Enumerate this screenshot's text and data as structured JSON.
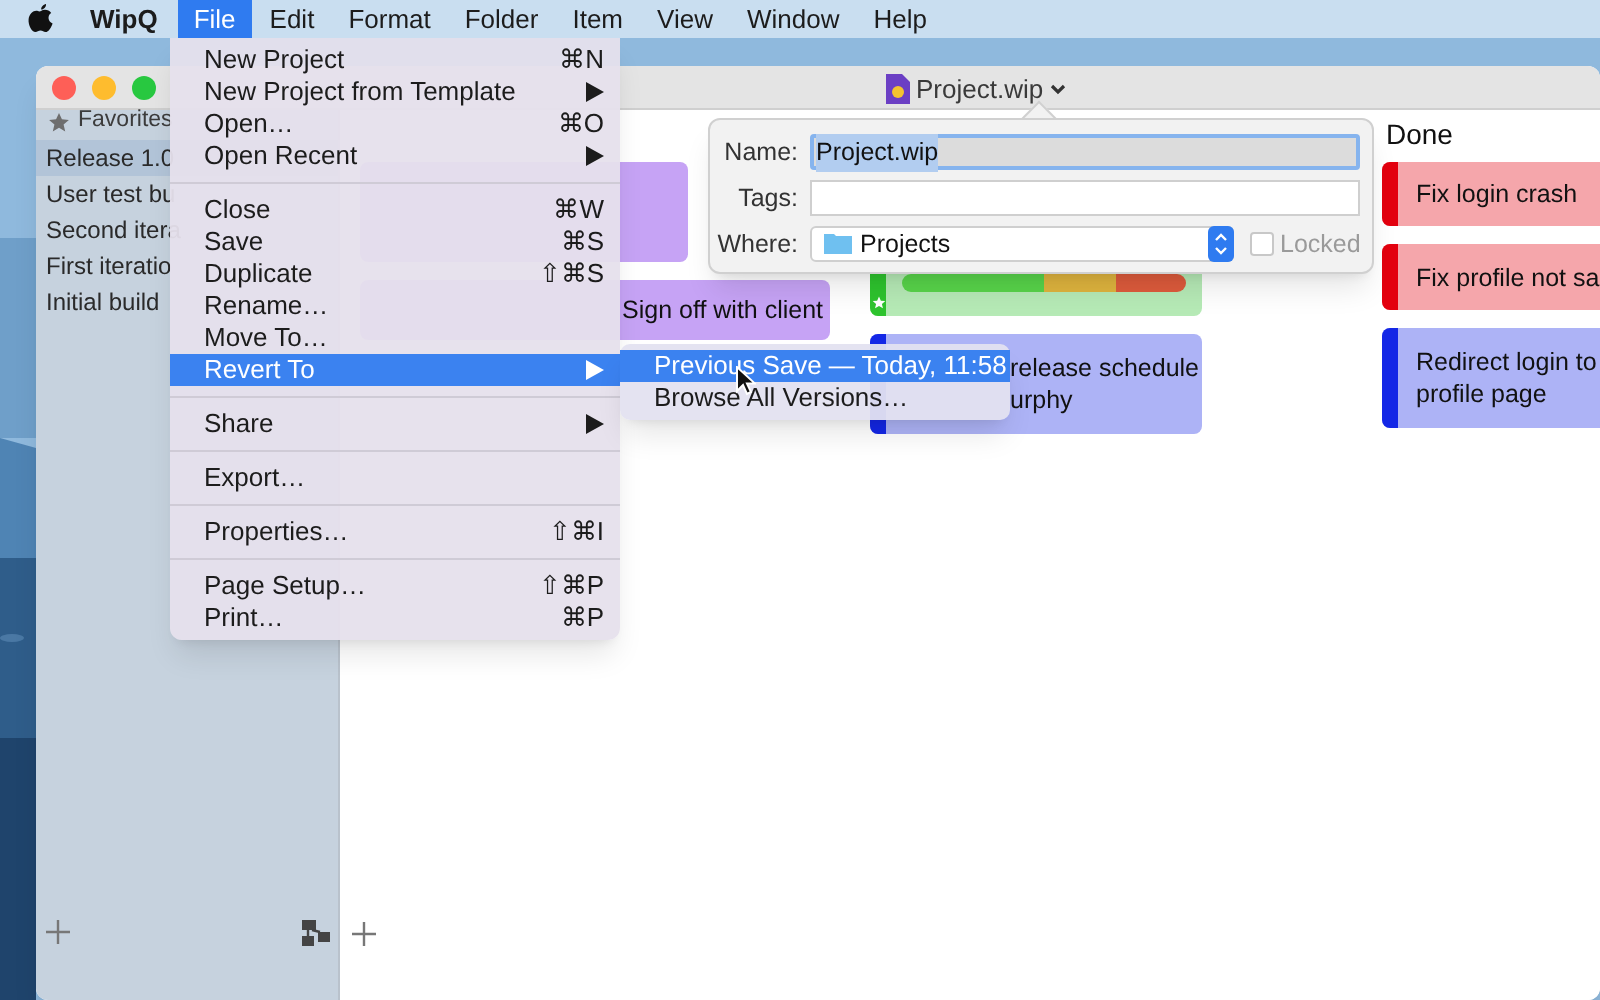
{
  "menu_bar": {
    "app": "WipQ",
    "menus": [
      {
        "label": "File",
        "selected": true
      },
      {
        "label": "Edit",
        "selected": false
      },
      {
        "label": "Format",
        "selected": false
      },
      {
        "label": "Folder",
        "selected": false
      },
      {
        "label": "Item",
        "selected": false
      },
      {
        "label": "View",
        "selected": false
      },
      {
        "label": "Window",
        "selected": false
      },
      {
        "label": "Help",
        "selected": false
      }
    ]
  },
  "window": {
    "title": "Project.wip"
  },
  "sidebar": {
    "favorites": "Favorites",
    "items": [
      {
        "label": "Release 1.0",
        "selected": true
      },
      {
        "label": "User test bu",
        "selected": false
      },
      {
        "label": "Second itera",
        "selected": false
      },
      {
        "label": "First iteratio",
        "selected": false
      },
      {
        "label": "Initial build",
        "selected": false
      }
    ]
  },
  "board": {
    "columns": [
      {
        "cards": [
          {
            "kind": "plain",
            "color": "#c6a3f5"
          },
          {
            "kind": "plain",
            "color": "#c6a3f5",
            "lines": [
              "Sign off with client"
            ]
          }
        ]
      },
      {
        "cards": [
          {
            "color": "#2ec42e",
            "starred": true,
            "kind": "progress"
          },
          {
            "color": "#1427e6",
            "lines": [
              "release schedule",
              "urphy"
            ]
          }
        ]
      },
      {
        "header": "Done",
        "cards": [
          {
            "color": "#e3000f",
            "lines": [
              "Fix login crash"
            ]
          },
          {
            "color": "#e3000f",
            "lines": [
              "Fix profile not sa"
            ]
          },
          {
            "color": "#1427e6",
            "lines": [
              "Redirect login to",
              "profile page"
            ]
          }
        ]
      }
    ]
  },
  "file_menu": {
    "sections": [
      [
        {
          "label": "New Project",
          "shortcut": "⌘N",
          "submenu": false,
          "selected": false
        },
        {
          "label": "New Project from Template",
          "submenu": true,
          "selected": false
        },
        {
          "label": "Open…",
          "shortcut": "⌘O",
          "submenu": false,
          "selected": false
        },
        {
          "label": "Open Recent",
          "submenu": true,
          "selected": false
        }
      ],
      [
        {
          "label": "Close",
          "shortcut": "⌘W",
          "submenu": false,
          "selected": false
        },
        {
          "label": "Save",
          "shortcut": "⌘S",
          "submenu": false,
          "selected": false
        },
        {
          "label": "Duplicate",
          "shortcut": "⇧⌘S",
          "submenu": false,
          "selected": false
        },
        {
          "label": "Rename…",
          "submenu": false,
          "selected": false
        },
        {
          "label": "Move To…",
          "submenu": false,
          "selected": false
        },
        {
          "label": "Revert To",
          "submenu": true,
          "selected": true
        }
      ],
      [
        {
          "label": "Share",
          "submenu": true,
          "selected": false
        }
      ],
      [
        {
          "label": "Export…",
          "submenu": false,
          "selected": false
        }
      ],
      [
        {
          "label": "Properties…",
          "shortcut": "⇧⌘I",
          "submenu": false,
          "selected": false
        }
      ],
      [
        {
          "label": "Page Setup…",
          "shortcut": "⇧⌘P",
          "submenu": false,
          "selected": false
        },
        {
          "label": "Print…",
          "shortcut": "⌘P",
          "submenu": false,
          "selected": false
        }
      ]
    ]
  },
  "revert_submenu": {
    "items": [
      {
        "label": "Previous Save — Today, 11:58",
        "selected": true
      },
      {
        "label": "Browse All Versions…",
        "selected": false
      }
    ]
  },
  "popover": {
    "name_label": "Name:",
    "name_value": "Project.wip",
    "tags_label": "Tags:",
    "where_label": "Where:",
    "where_value": "Projects",
    "locked": {
      "label": "Locked",
      "checked": false
    }
  }
}
